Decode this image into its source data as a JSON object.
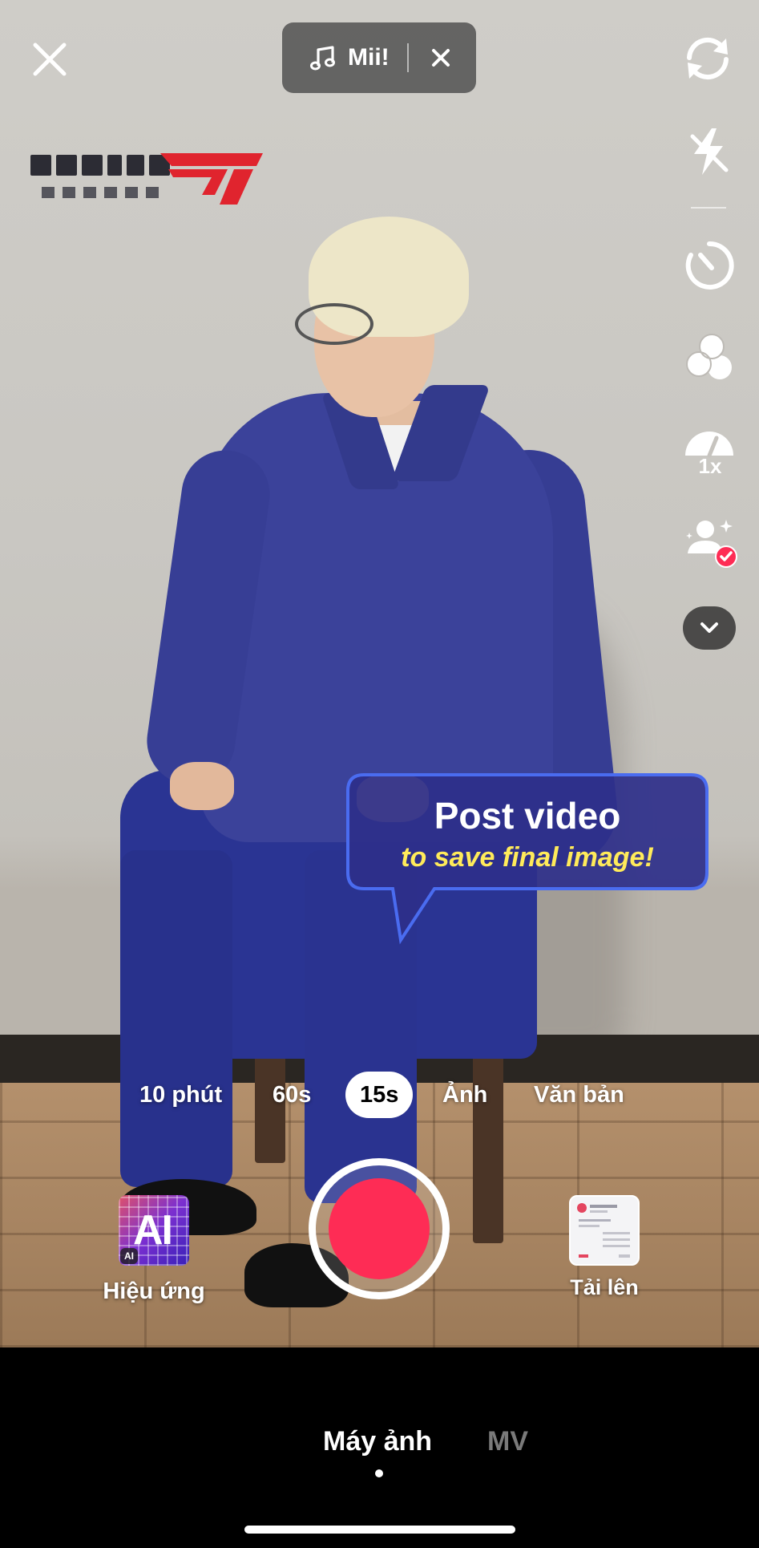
{
  "top_bar": {
    "sound_name": "Mii!"
  },
  "side_tools": {
    "speed_label": "1x"
  },
  "tooltip": {
    "title": "Post video",
    "subtitle": "to save final image!"
  },
  "modes": {
    "items": [
      "10 phút",
      "60s",
      "15s",
      "Ảnh",
      "Văn bản"
    ],
    "selected": "15s"
  },
  "effects": {
    "thumb_text": "AI",
    "badge": "AI",
    "label": "Hiệu ứng"
  },
  "upload": {
    "label": "Tải lên"
  },
  "bottom_tabs": {
    "camera": "Máy ảnh",
    "mv": "MV"
  },
  "colors": {
    "record": "#fe2c55",
    "tooltip_bg": "#2e2f8a",
    "tooltip_border": "#4a6cf0",
    "tooltip_sub": "#ffeb5a",
    "logo_red": "#e0242e"
  }
}
